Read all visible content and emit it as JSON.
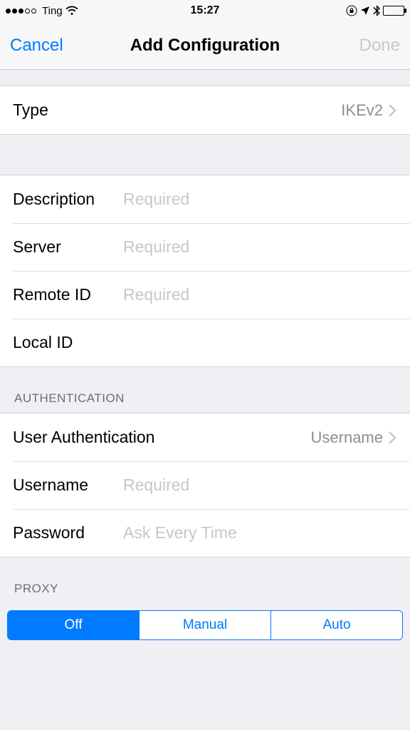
{
  "statusbar": {
    "carrier": "Ting",
    "time": "15:27"
  },
  "nav": {
    "cancel": "Cancel",
    "title": "Add Configuration",
    "done": "Done"
  },
  "type_row": {
    "label": "Type",
    "value": "IKEv2"
  },
  "config": {
    "description_label": "Description",
    "description_placeholder": "Required",
    "server_label": "Server",
    "server_placeholder": "Required",
    "remoteid_label": "Remote ID",
    "remoteid_placeholder": "Required",
    "localid_label": "Local ID",
    "localid_placeholder": ""
  },
  "auth": {
    "header": "AUTHENTICATION",
    "userauth_label": "User Authentication",
    "userauth_value": "Username",
    "username_label": "Username",
    "username_placeholder": "Required",
    "password_label": "Password",
    "password_placeholder": "Ask Every Time"
  },
  "proxy": {
    "header": "PROXY",
    "options": {
      "off": "Off",
      "manual": "Manual",
      "auto": "Auto"
    }
  }
}
